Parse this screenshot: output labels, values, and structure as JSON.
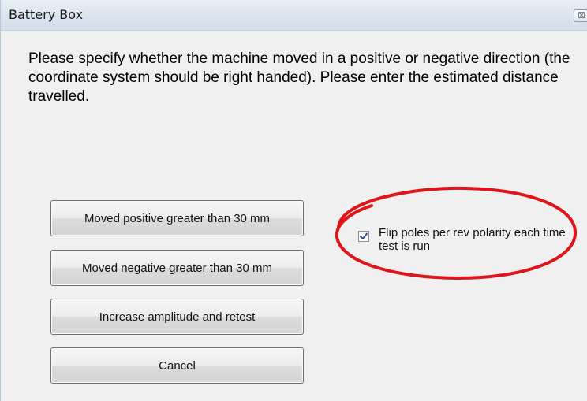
{
  "window": {
    "title": "Battery Box",
    "close_glyph": "⊠"
  },
  "message": "Please specify whether the machine moved in a positive or negative direction (the coordinate system should be right handed). Please enter the estimated distance travelled.",
  "buttons": {
    "moved_positive": "Moved positive greater than 30 mm",
    "moved_negative": "Moved negative greater than 30 mm",
    "increase_amplitude": "Increase amplitude and retest",
    "cancel": "Cancel"
  },
  "checkbox": {
    "label": "Flip poles per rev polarity each time test is run",
    "checked": true
  },
  "annotation": {
    "shape": "ellipse",
    "color": "#e0141b"
  },
  "colors": {
    "titlebar": "#dbe4ef",
    "dialog_bg": "#f0f0f0",
    "check_mark": "#2c4fa0"
  }
}
